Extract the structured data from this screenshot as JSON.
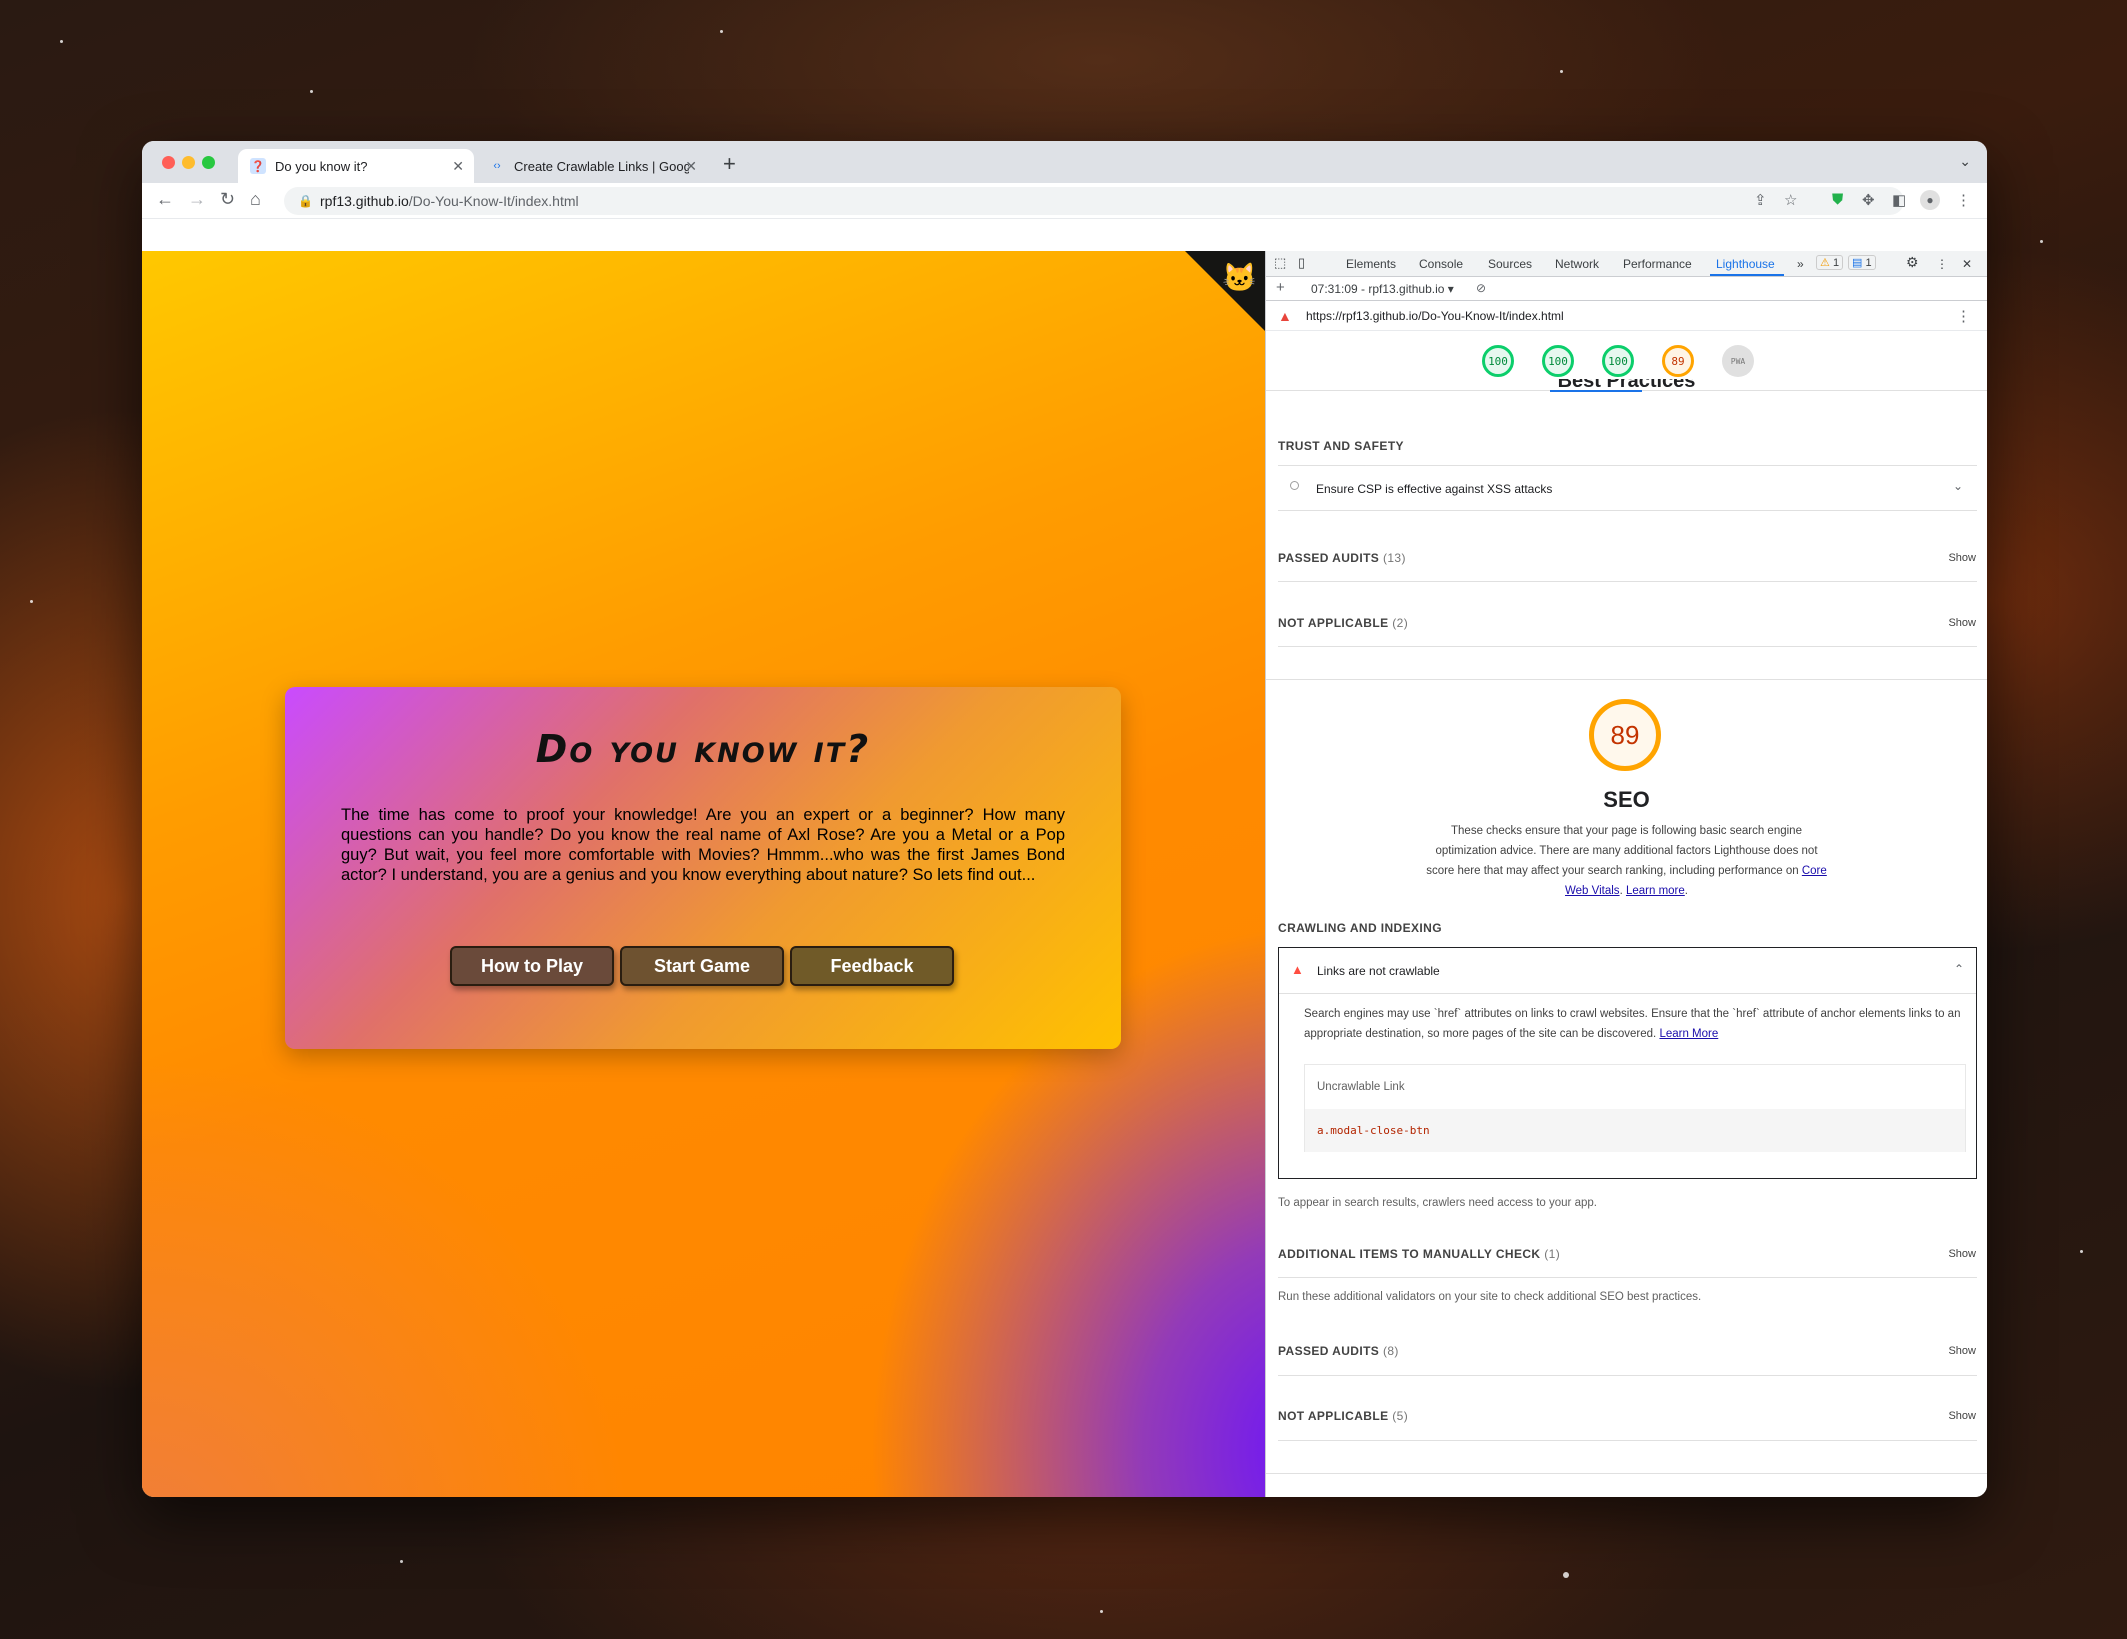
{
  "browser": {
    "tabs": [
      {
        "title": "Do you know it?",
        "active": true
      },
      {
        "title": "Create Crawlable Links | Googl",
        "active": false
      }
    ],
    "new_tab": "+",
    "url_host": "rpf13.github.io",
    "url_path": "/Do-You-Know-It/index.html"
  },
  "page": {
    "title": "Do you know it?",
    "intro": "The time has come to proof your knowledge! Are you an expert or a beginner? How many questions can you handle? Do you know the real name of Axl Rose? Are you a Metal or a Pop guy? But wait, you feel more comfortable with Movies? Hmmm...who was the first James Bond actor? I understand, you are a genius and you know everything about nature? So lets find out...",
    "buttons": [
      "How to Play",
      "Start Game",
      "Feedback"
    ]
  },
  "devtools": {
    "tabs": [
      "Elements",
      "Console",
      "Sources",
      "Network",
      "Performance",
      "Lighthouse"
    ],
    "warnings": "1",
    "messages": "1",
    "report_select": "07:31:09 - rpf13.github.io",
    "report_url": "https://rpf13.github.io/Do-You-Know-It/index.html",
    "gauges": [
      "100",
      "100",
      "100",
      "89",
      "PWA"
    ],
    "bp_heading_cut": "Best Practices",
    "trust_label": "TRUST AND SAFETY",
    "csp_audit": "Ensure CSP is effective against XSS attacks",
    "bp_passed_label": "PASSED AUDITS",
    "bp_passed_count": "(13)",
    "bp_na_label": "NOT APPLICABLE",
    "bp_na_count": "(2)",
    "show": "Show",
    "seo_score": "89",
    "seo_title": "SEO",
    "seo_desc": "These checks ensure that your page is following basic search engine optimization advice. There are many additional factors Lighthouse does not score here that may affect your search ranking, including performance on",
    "seo_link1": "Core Web Vitals",
    "seo_sep": ".",
    "seo_link2": "Learn more",
    "seo_end": ".",
    "crawl_label": "CRAWLING AND INDEXING",
    "crawl_audit": "Links are not crawlable",
    "crawl_desc": "Search engines may use `href` attributes on links to crawl websites. Ensure that the `href` attribute of anchor elements links to an appropriate destination, so more pages of the site can be discovered.",
    "crawl_learn": "Learn More",
    "uncrawl_header": "Uncrawlable Link",
    "uncrawl_value": "a.modal-close-btn",
    "crawl_note": "To appear in search results, crawlers need access to your app.",
    "manual_label": "ADDITIONAL ITEMS TO MANUALLY CHECK",
    "manual_count": "(1)",
    "manual_desc": "Run these additional validators on your site to check additional SEO best practices.",
    "seo_passed_label": "PASSED AUDITS",
    "seo_passed_count": "(8)",
    "seo_na_label": "NOT APPLICABLE",
    "seo_na_count": "(5)"
  },
  "colors": {
    "pass": "#0cce6b",
    "average": "#ffa400",
    "fail": "#ff4e42",
    "accent": "#1a73e8"
  }
}
